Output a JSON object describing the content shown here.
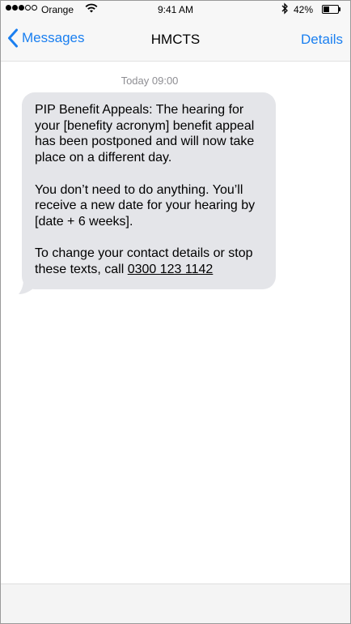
{
  "status_bar": {
    "carrier": "Orange",
    "time": "9:41 AM",
    "battery_percent": "42%",
    "battery_level": 0.42,
    "signal_bars": 3,
    "signal_total": 5
  },
  "nav": {
    "back_label": "Messages",
    "title": "HMCTS",
    "details_label": "Details"
  },
  "conversation": {
    "timestamp": "Today 09:00",
    "message": {
      "paragraph1": "PIP Benefit Appeals: The hearing for your [benefity acronym] benefit appeal has been postponed and will now take place on a different day.",
      "paragraph2": "You don’t need to do anything. You’ll receive a new date for your hearing by [date + 6 weeks].",
      "paragraph3_prefix": "To change your contact details or stop these texts, call ",
      "phone_number": "0300 123 1142"
    }
  },
  "colors": {
    "accent": "#1a7ff0",
    "bubble": "#e4e5e9",
    "timestamp": "#8e8e93"
  },
  "icons": {
    "signal": "signal-dots-icon",
    "wifi": "wifi-icon",
    "bluetooth": "bluetooth-icon",
    "battery": "battery-icon",
    "back": "chevron-left-icon"
  }
}
